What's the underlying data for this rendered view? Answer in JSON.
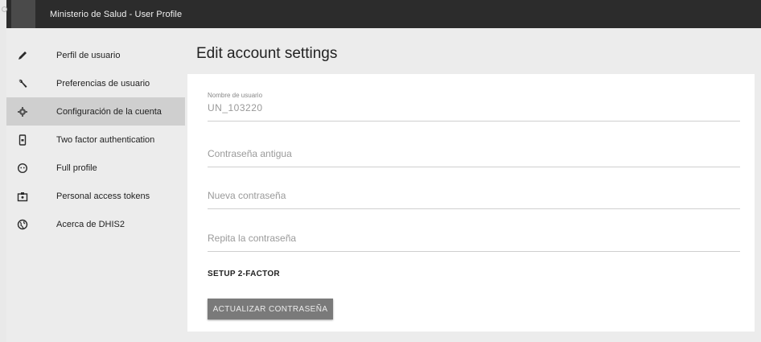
{
  "header": {
    "title": "Ministerio de Salud - User Profile"
  },
  "sidebar": {
    "items": [
      {
        "label": "Perfil de usuario",
        "icon": "pencil-icon",
        "active": false
      },
      {
        "label": "Preferencias de usuario",
        "icon": "wrench-icon",
        "active": false
      },
      {
        "label": "Configuración de la cuenta",
        "icon": "gear-icon",
        "active": true
      },
      {
        "label": "Two factor authentication",
        "icon": "phone-lock-icon",
        "active": false
      },
      {
        "label": "Full profile",
        "icon": "face-icon",
        "active": false
      },
      {
        "label": "Personal access tokens",
        "icon": "badge-icon",
        "active": false
      },
      {
        "label": "Acerca de DHIS2",
        "icon": "globe-icon",
        "active": false
      }
    ]
  },
  "main": {
    "title": "Edit account settings",
    "username": {
      "label": "Nombre de usuario",
      "value": "UN_103220"
    },
    "old_password": {
      "placeholder": "Contraseña antigua"
    },
    "new_password": {
      "placeholder": "Nueva contraseña"
    },
    "repeat_password": {
      "placeholder": "Repita la contraseña"
    },
    "setup_2fa_label": "SETUP 2-FACTOR",
    "update_button_label": "ACTUALIZAR CONTRASEÑA"
  }
}
